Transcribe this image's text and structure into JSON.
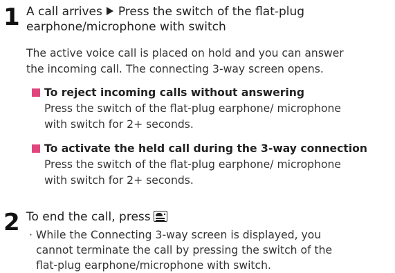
{
  "colors": {
    "accent_square": "#e0457b",
    "text": "#333333"
  },
  "step1": {
    "number": "1",
    "title_part1": "A call arrives",
    "arrow_icon": "triangle-right-icon",
    "title_part2": "Press the switch of the flat-plug",
    "title_line2": "earphone/microphone with switch",
    "desc_line1": "The active voice call is placed on hold and you can answer",
    "desc_line2": "the incoming call. The connecting 3-way screen opens.",
    "note1": {
      "heading": "To reject incoming calls without answering",
      "body_line1": "Press the switch of the flat-plug earphone/ microphone",
      "body_line2": "with switch for 2+ seconds."
    },
    "note2": {
      "heading": "To activate the held call during the 3-way connection",
      "body_line1": "Press the switch of the flat-plug earphone/ microphone",
      "body_line2": "with switch for 2+ seconds."
    }
  },
  "step2": {
    "number": "2",
    "title": "To end the call, press",
    "key_icon": "end-call-key-icon",
    "bullet_line1": "· While the Connecting 3-way screen is displayed, you",
    "bullet_line2": "cannot terminate the call by pressing the switch of the",
    "bullet_line3": "flat-plug earphone/microphone with switch."
  }
}
